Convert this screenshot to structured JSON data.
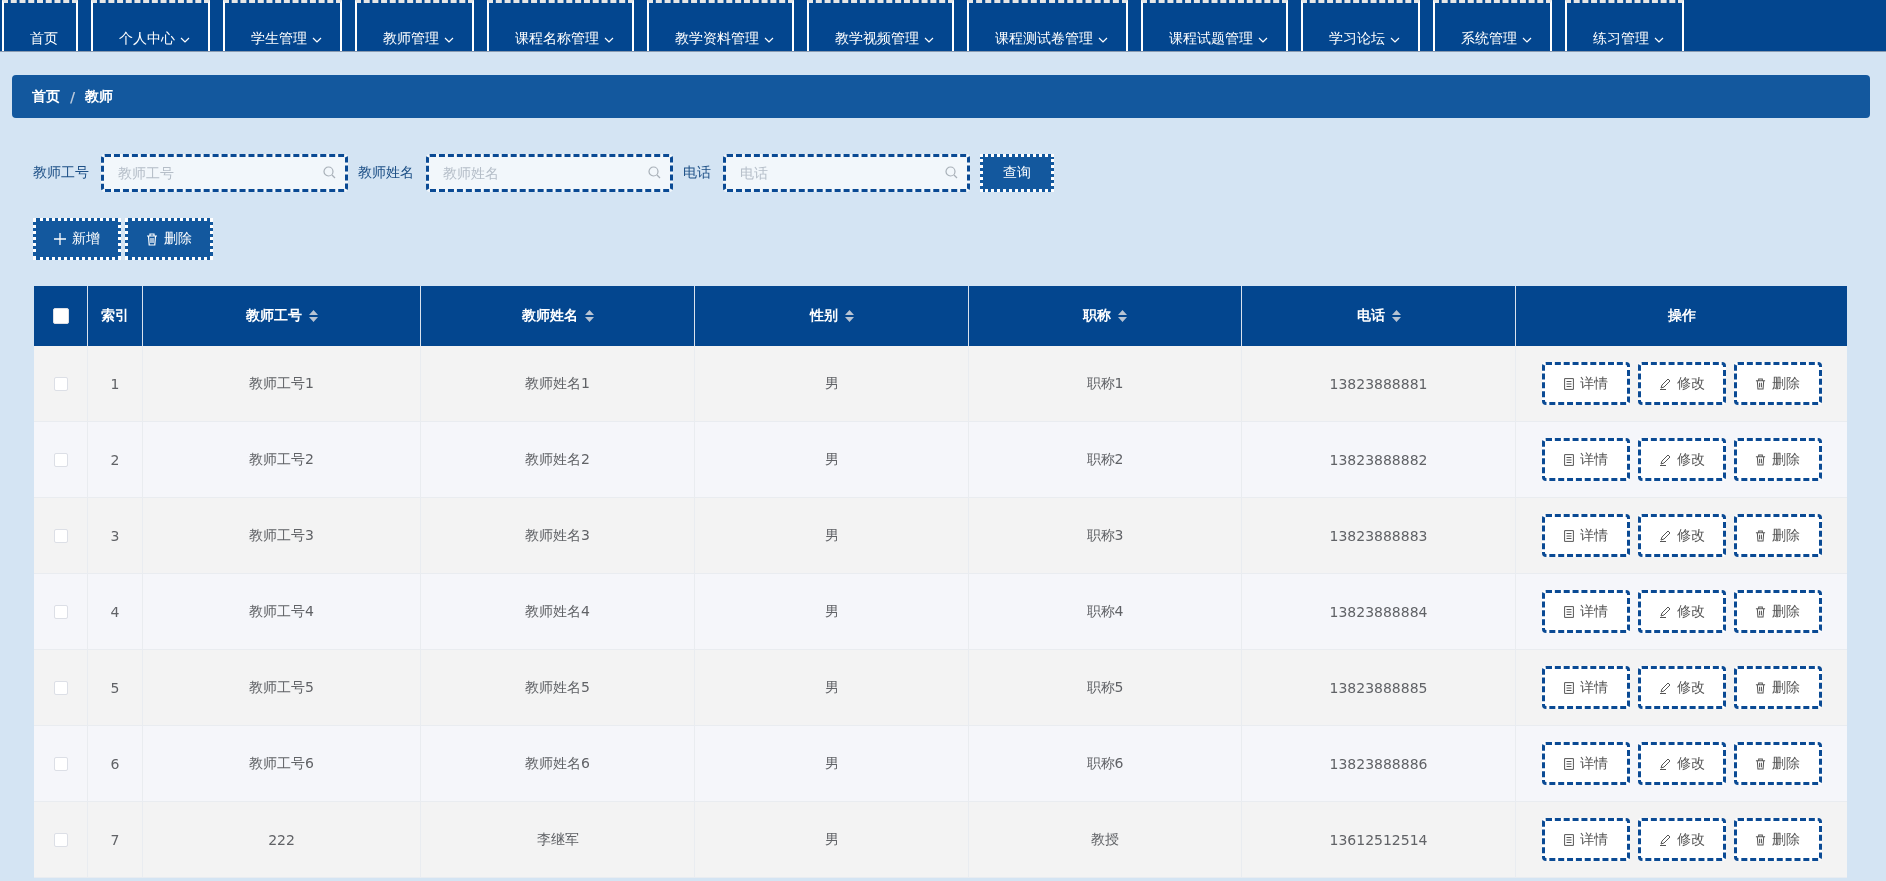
{
  "nav": [
    {
      "label": "首页",
      "dropdown": false
    },
    {
      "label": "个人中心",
      "dropdown": true
    },
    {
      "label": "学生管理",
      "dropdown": true
    },
    {
      "label": "教师管理",
      "dropdown": true
    },
    {
      "label": "课程名称管理",
      "dropdown": true
    },
    {
      "label": "教学资料管理",
      "dropdown": true
    },
    {
      "label": "教学视频管理",
      "dropdown": true
    },
    {
      "label": "课程测试卷管理",
      "dropdown": true
    },
    {
      "label": "课程试题管理",
      "dropdown": true
    },
    {
      "label": "学习论坛",
      "dropdown": true
    },
    {
      "label": "系统管理",
      "dropdown": true
    },
    {
      "label": "练习管理",
      "dropdown": true
    }
  ],
  "breadcrumb": {
    "items": [
      "首页",
      "教师"
    ],
    "separator": "/"
  },
  "search": {
    "fields": [
      {
        "label": "教师工号",
        "placeholder": "教师工号"
      },
      {
        "label": "教师姓名",
        "placeholder": "教师姓名"
      },
      {
        "label": "电话",
        "placeholder": "电话"
      }
    ],
    "button": "查询"
  },
  "toolbar": [
    {
      "kind": "add",
      "label": "新增"
    },
    {
      "kind": "delete",
      "label": "删除"
    }
  ],
  "table": {
    "select_all": {
      "checked": false
    },
    "columns": [
      {
        "label": "索引",
        "sortable": false
      },
      {
        "label": "教师工号",
        "sortable": true
      },
      {
        "label": "教师姓名",
        "sortable": true
      },
      {
        "label": "性别",
        "sortable": true
      },
      {
        "label": "职称",
        "sortable": true
      },
      {
        "label": "电话",
        "sortable": true
      },
      {
        "label": "操作",
        "sortable": false
      }
    ],
    "rows": [
      {
        "checked": false,
        "cells": [
          "1",
          "教师工号1",
          "教师姓名1",
          "男",
          "职称1",
          "13823888881"
        ],
        "actions": [
          {
            "kind": "detail",
            "label": "详情"
          },
          {
            "kind": "edit",
            "label": "修改"
          },
          {
            "kind": "delete",
            "label": "删除"
          }
        ]
      },
      {
        "checked": false,
        "cells": [
          "2",
          "教师工号2",
          "教师姓名2",
          "男",
          "职称2",
          "13823888882"
        ],
        "actions": [
          {
            "kind": "detail",
            "label": "详情"
          },
          {
            "kind": "edit",
            "label": "修改"
          },
          {
            "kind": "delete",
            "label": "删除"
          }
        ]
      },
      {
        "checked": false,
        "cells": [
          "3",
          "教师工号3",
          "教师姓名3",
          "男",
          "职称3",
          "13823888883"
        ],
        "actions": [
          {
            "kind": "detail",
            "label": "详情"
          },
          {
            "kind": "edit",
            "label": "修改"
          },
          {
            "kind": "delete",
            "label": "删除"
          }
        ]
      },
      {
        "checked": false,
        "cells": [
          "4",
          "教师工号4",
          "教师姓名4",
          "男",
          "职称4",
          "13823888884"
        ],
        "actions": [
          {
            "kind": "detail",
            "label": "详情"
          },
          {
            "kind": "edit",
            "label": "修改"
          },
          {
            "kind": "delete",
            "label": "删除"
          }
        ]
      },
      {
        "checked": false,
        "cells": [
          "5",
          "教师工号5",
          "教师姓名5",
          "男",
          "职称5",
          "13823888885"
        ],
        "actions": [
          {
            "kind": "detail",
            "label": "详情"
          },
          {
            "kind": "edit",
            "label": "修改"
          },
          {
            "kind": "delete",
            "label": "删除"
          }
        ]
      },
      {
        "checked": false,
        "cells": [
          "6",
          "教师工号6",
          "教师姓名6",
          "男",
          "职称6",
          "13823888886"
        ],
        "actions": [
          {
            "kind": "detail",
            "label": "详情"
          },
          {
            "kind": "edit",
            "label": "修改"
          },
          {
            "kind": "delete",
            "label": "删除"
          }
        ]
      },
      {
        "checked": false,
        "cells": [
          "7",
          "222",
          "李继军",
          "男",
          "教授",
          "13612512514"
        ],
        "actions": [
          {
            "kind": "detail",
            "label": "详情"
          },
          {
            "kind": "edit",
            "label": "修改"
          },
          {
            "kind": "delete",
            "label": "删除"
          }
        ]
      }
    ]
  }
}
